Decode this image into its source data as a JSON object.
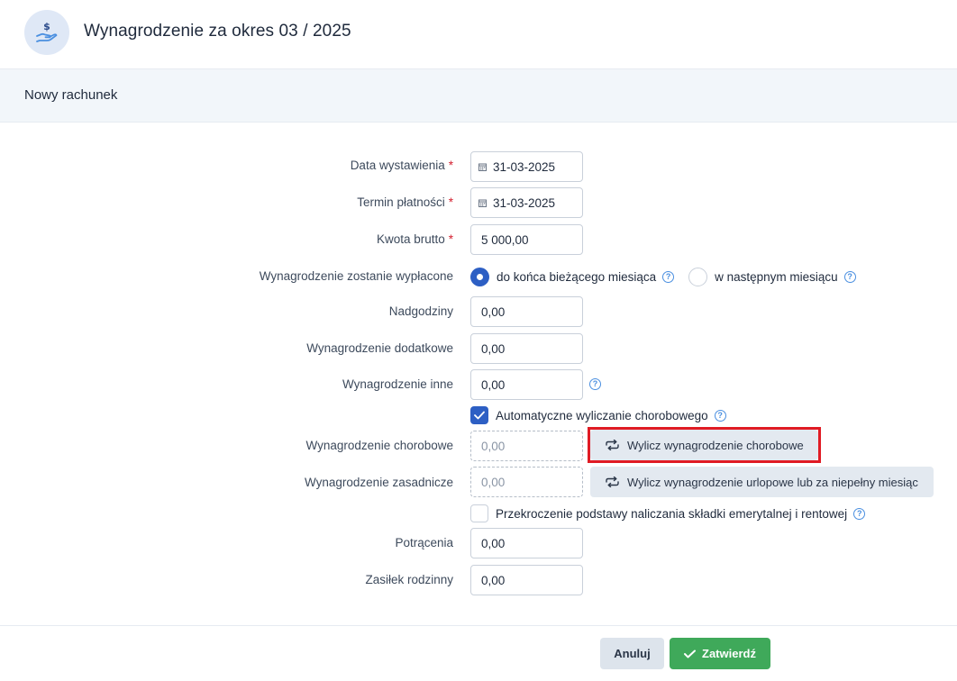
{
  "header": {
    "title": "Wynagrodzenie za okres 03 / 2025",
    "icon": "salary-hand-dollar-icon"
  },
  "subheader": {
    "title": "Nowy rachunek"
  },
  "form": {
    "data_wystawienia": {
      "label": "Data wystawienia",
      "value": "31-03-2025",
      "required": "*"
    },
    "termin_platnosci": {
      "label": "Termin płatności",
      "value": "31-03-2025",
      "required": "*"
    },
    "kwota_brutto": {
      "label": "Kwota brutto",
      "value": "5 000,00",
      "required": "*"
    },
    "wyplata": {
      "label": "Wynagrodzenie zostanie wypłacone",
      "option1": "do końca bieżącego miesiąca",
      "option2": "w następnym miesiącu"
    },
    "nadgodziny": {
      "label": "Nadgodziny",
      "value": "0,00"
    },
    "dodatkowe": {
      "label": "Wynagrodzenie dodatkowe",
      "value": "0,00"
    },
    "inne": {
      "label": "Wynagrodzenie inne",
      "value": "0,00"
    },
    "auto_chorobowe": {
      "label": "Automatyczne wyliczanie chorobowego"
    },
    "chorobowe": {
      "label": "Wynagrodzenie chorobowe",
      "value": "0,00",
      "button": "Wylicz wynagrodzenie chorobowe"
    },
    "zasadnicze": {
      "label": "Wynagrodzenie zasadnicze",
      "value": "0,00",
      "button": "Wylicz wynagrodzenie urlopowe lub za niepełny miesiąc"
    },
    "przekroczenie": {
      "label": "Przekroczenie podstawy naliczania składki emerytalnej i rentowej"
    },
    "potracenia": {
      "label": "Potrącenia",
      "value": "0,00"
    },
    "zasilek": {
      "label": "Zasiłek rodzinny",
      "value": "0,00"
    }
  },
  "footer": {
    "cancel": "Anuluj",
    "confirm": "Zatwierdź"
  },
  "colors": {
    "primary": "#2d5fc4",
    "confirm": "#3fa95a",
    "highlight": "#e01b24"
  }
}
